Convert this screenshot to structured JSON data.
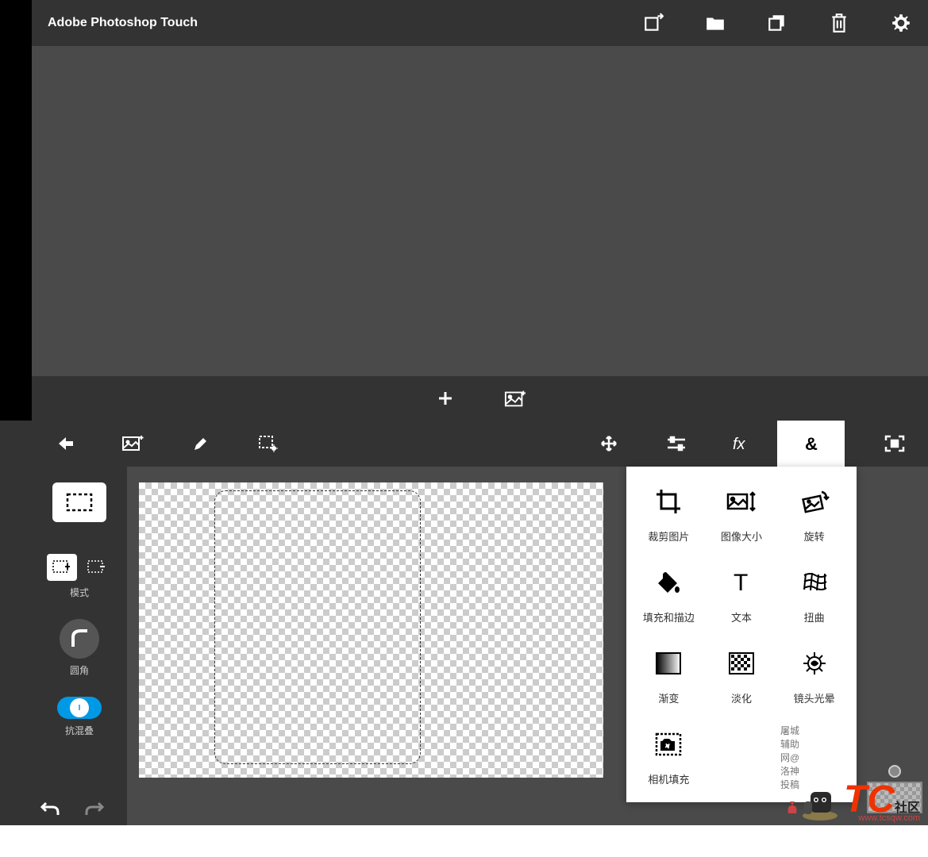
{
  "app": {
    "title": "Adobe Photoshop Touch"
  },
  "left_tools": {
    "mode_label": "模式",
    "corner_label": "圆角",
    "antialias_label": "抗混叠"
  },
  "context_menu": {
    "items": [
      {
        "label": "裁剪图片"
      },
      {
        "label": "图像大小"
      },
      {
        "label": "旋转"
      },
      {
        "label": "填充和描边"
      },
      {
        "label": "文本"
      },
      {
        "label": "扭曲"
      },
      {
        "label": "渐变"
      },
      {
        "label": "淡化"
      },
      {
        "label": "镜头光晕"
      },
      {
        "label": "相机填充"
      }
    ]
  },
  "watermark": {
    "t": "T",
    "c": "C",
    "suffix": "社区",
    "url": "www.tcsqw.com",
    "credit": "屠城辅助网@洛神投稿"
  }
}
